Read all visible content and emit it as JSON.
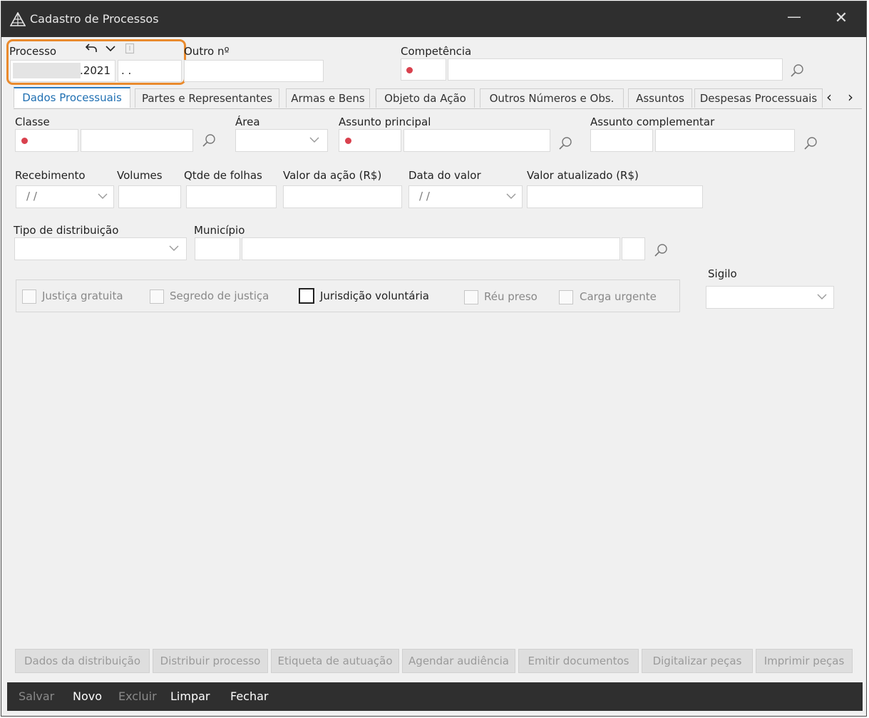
{
  "window": {
    "title": "Cadastro de Processos",
    "minimize": "—",
    "close": "✕"
  },
  "header": {
    "processo_label": "Processo",
    "processo_year": ".2021",
    "processo_suffix": ". .",
    "outro_label": "Outro nº",
    "outro_value": "",
    "competencia_label": "Competência",
    "competencia_code": "",
    "competencia_desc": ""
  },
  "tabs": [
    {
      "label": "Dados Processuais",
      "active": true
    },
    {
      "label": "Partes e Representantes",
      "active": false
    },
    {
      "label": "Armas e Bens",
      "active": false
    },
    {
      "label": "Objeto da Ação",
      "active": false
    },
    {
      "label": "Outros Números e Obs.",
      "active": false
    },
    {
      "label": "Assuntos",
      "active": false
    },
    {
      "label": "Despesas Processuais",
      "active": false
    }
  ],
  "tab_scroll": {
    "left": "‹",
    "right": "›"
  },
  "form": {
    "classe_label": "Classe",
    "area_label": "Área",
    "assunto_principal_label": "Assunto principal",
    "assunto_complementar_label": "Assunto complementar",
    "recebimento_label": "Recebimento",
    "recebimento_value": "/ /",
    "volumes_label": "Volumes",
    "qtde_folhas_label": "Qtde de folhas",
    "valor_acao_label": "Valor da ação (R$)",
    "data_valor_label": "Data do valor",
    "data_valor_value": "/ /",
    "valor_atualizado_label": "Valor atualizado (R$)",
    "tipo_distribuicao_label": "Tipo de distribuição",
    "municipio_label": "Município",
    "sigilo_label": "Sigilo"
  },
  "checkboxes": [
    {
      "label": "Justiça gratuita",
      "enabled": false
    },
    {
      "label": "Segredo de justiça",
      "enabled": false
    },
    {
      "label": "Jurisdição voluntária",
      "enabled": true
    },
    {
      "label": "Réu preso",
      "enabled": false
    },
    {
      "label": "Carga urgente",
      "enabled": false
    }
  ],
  "actions": [
    "Dados da distribuição",
    "Distribuir processo",
    "Etiqueta de autuação",
    "Agendar audiência",
    "Emitir documentos",
    "Digitalizar peças",
    "Imprimir peças"
  ],
  "bottom": {
    "salvar": "Salvar",
    "novo": "Novo",
    "excluir": "Excluir",
    "limpar": "Limpar",
    "fechar": "Fechar"
  },
  "colors": {
    "required_dot": "#d9414e",
    "highlight": "#e98a2d",
    "active_tab": "#1f6fb2",
    "titlebar": "#2f2f2f"
  }
}
